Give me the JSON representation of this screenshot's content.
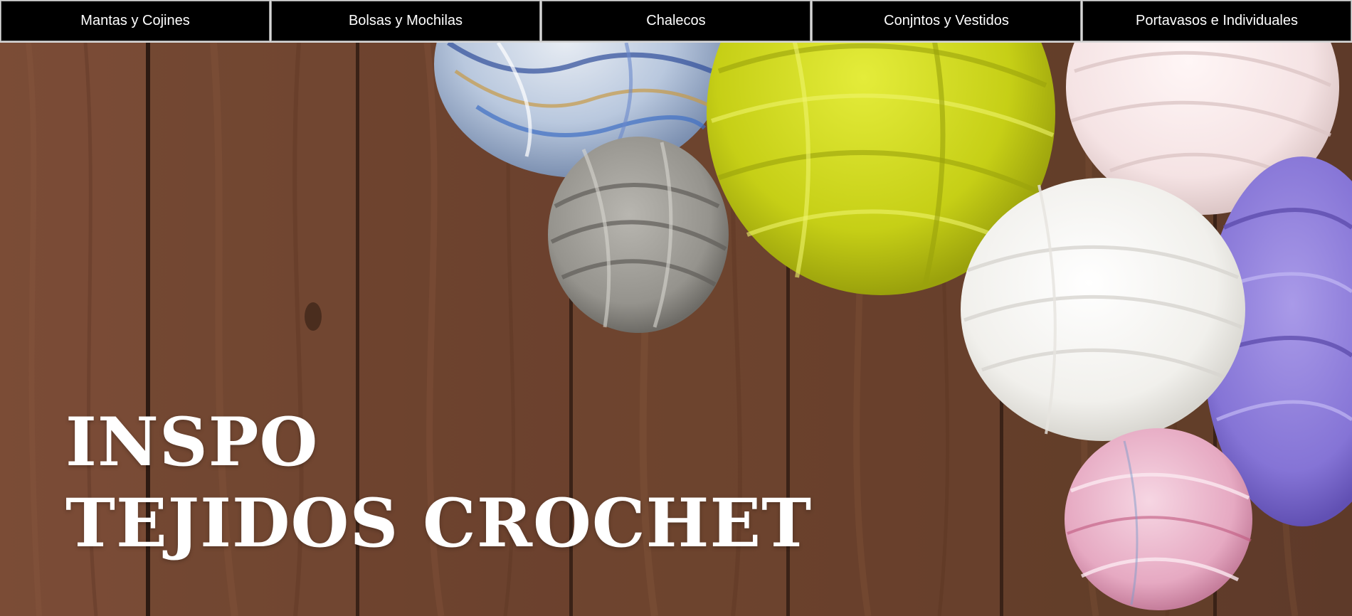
{
  "nav": {
    "items": [
      {
        "label": "Mantas y Cojines"
      },
      {
        "label": "Bolsas y Mochilas"
      },
      {
        "label": "Chalecos"
      },
      {
        "label": "Conjntos y Vestidos"
      },
      {
        "label": "Portavasos e Individuales"
      }
    ]
  },
  "hero": {
    "title_line1": "INSPO",
    "title_line2": "TEJIDOS CROCHET",
    "image_description_icons": [
      "yarn-ball-multicolor",
      "yarn-ball-gray",
      "yarn-ball-lime",
      "yarn-ball-light-pink",
      "yarn-ball-white",
      "yarn-ball-purple",
      "yarn-ball-pink"
    ]
  },
  "colors": {
    "nav_bg": "#000000",
    "nav_text": "#ffffff",
    "wood": "#6b4330",
    "title": "#ffffff"
  }
}
